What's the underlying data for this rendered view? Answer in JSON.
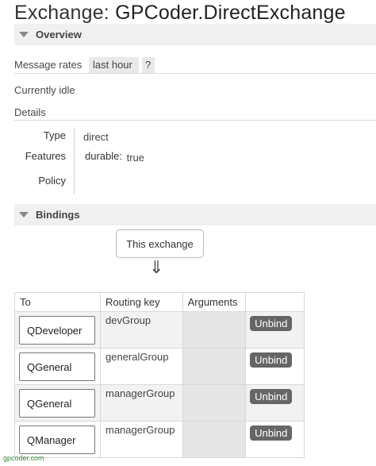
{
  "page": {
    "title_prefix": "Exchange: ",
    "title_name": "GPCoder.DirectExchange"
  },
  "overview": {
    "header": "Overview",
    "message_rates_label": "Message rates",
    "message_rates_range": "last hour",
    "message_rates_help": "?",
    "status": "Currently idle",
    "details_label": "Details",
    "type_key": "Type",
    "type_value": "direct",
    "features_key": "Features",
    "durable_key": "durable:",
    "durable_value": "true",
    "policy_key": "Policy",
    "policy_value": ""
  },
  "bindings": {
    "header": "Bindings",
    "this_exchange": "This exchange",
    "arrow": "⇓",
    "columns": [
      "To",
      "Routing key",
      "Arguments",
      ""
    ],
    "rows": [
      {
        "to": "QDeveloper",
        "routing_key": "devGroup",
        "arguments": "",
        "action": "Unbind"
      },
      {
        "to": "QGeneral",
        "routing_key": "generalGroup",
        "arguments": "",
        "action": "Unbind"
      },
      {
        "to": "QGeneral",
        "routing_key": "managerGroup",
        "arguments": "",
        "action": "Unbind"
      },
      {
        "to": "QManager",
        "routing_key": "managerGroup",
        "arguments": "",
        "action": "Unbind"
      }
    ]
  },
  "watermark": "gpcoder.com",
  "colors": {
    "section_bg": "#f0f0f0",
    "button_bg": "#666666",
    "watermark": "#3a8a3a"
  }
}
